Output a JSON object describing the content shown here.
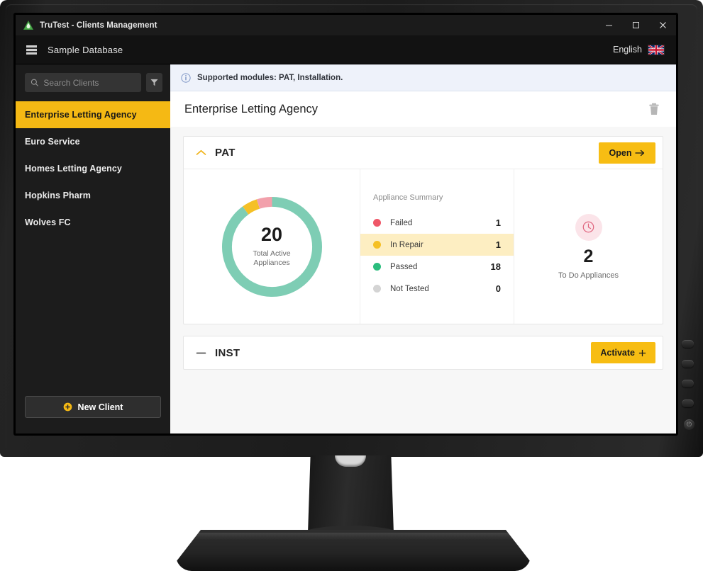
{
  "window": {
    "title": "TruTest - Clients Management",
    "logo_icon": "trutest-logo",
    "minimize_label": "–",
    "maximize_label": "❑",
    "close_label": "✕"
  },
  "header": {
    "menu_icon": "database-list-icon",
    "database_name": "Sample Database",
    "language_label": "English",
    "flag_icon": "union-jack-flag-icon"
  },
  "sidebar": {
    "search": {
      "placeholder": "Search Clients",
      "value": "",
      "icon": "search-icon"
    },
    "filter_icon": "filter-funnel-icon",
    "clients": [
      {
        "name": "Enterprise Letting Agency",
        "selected": true
      },
      {
        "name": "Euro Service",
        "selected": false
      },
      {
        "name": "Homes Letting Agency",
        "selected": false
      },
      {
        "name": "Hopkins Pharm",
        "selected": false
      },
      {
        "name": "Wolves FC",
        "selected": false
      }
    ],
    "new_client_label": "New Client",
    "new_client_icon": "plus-circle-icon"
  },
  "main": {
    "info_banner": {
      "icon": "info-icon",
      "text": "Supported modules: PAT, Installation."
    },
    "page_title": "Enterprise Letting Agency",
    "delete_icon": "trash-icon",
    "cards": [
      {
        "id": "pat",
        "title": "PAT",
        "expanded": true,
        "collapse_icon": "chevron-up-icon",
        "action_label": "Open",
        "action_icon": "arrow-right-icon"
      },
      {
        "id": "inst",
        "title": "INST",
        "expanded": false,
        "collapse_icon": "minus-icon",
        "action_label": "Activate",
        "action_icon": "plus-icon"
      }
    ],
    "pat_body": {
      "donut": {
        "total": "20",
        "caption_line1": "Total Active",
        "caption_line2": "Appliances"
      },
      "summary_title": "Appliance Summary",
      "summary_rows": [
        {
          "label": "Failed",
          "value": "1",
          "color": "#ef5768",
          "highlight": false
        },
        {
          "label": "In Repair",
          "value": "1",
          "color": "#f5c026",
          "highlight": true
        },
        {
          "label": "Passed",
          "value": "18",
          "color": "#2bbd7e",
          "highlight": false
        },
        {
          "label": "Not Tested",
          "value": "0",
          "color": "#d4d4d4",
          "highlight": false
        }
      ],
      "todo": {
        "icon": "clock-icon",
        "count": "2",
        "caption": "To Do Appliances"
      }
    }
  },
  "colors": {
    "accent_yellow": "#f7bd13",
    "selected_yellow": "#f5b914",
    "highlight_row": "#fdeec2",
    "donut_passed": "#7ecdb4",
    "donut_failed": "#f2a0ab",
    "donut_inrepair": "#f5c026",
    "info_banner_bg": "#eef2fa",
    "sidebar_bg": "#1c1c1c",
    "titlebar_bg": "#1b1b1b"
  },
  "chart_data": {
    "type": "pie",
    "title": "Appliance Summary",
    "subtitle": "Total Active Appliances",
    "center_value": 20,
    "labels": [
      "Passed",
      "Failed",
      "In Repair",
      "Not Tested"
    ],
    "values": [
      18,
      1,
      1,
      0
    ],
    "colors": [
      "#7ecdb4",
      "#f2a0ab",
      "#f5c026",
      "#d4d4d4"
    ],
    "legend": "right",
    "donut": true
  },
  "monitor": {
    "bezel_button_count": 4,
    "power_icon": "power-icon"
  }
}
